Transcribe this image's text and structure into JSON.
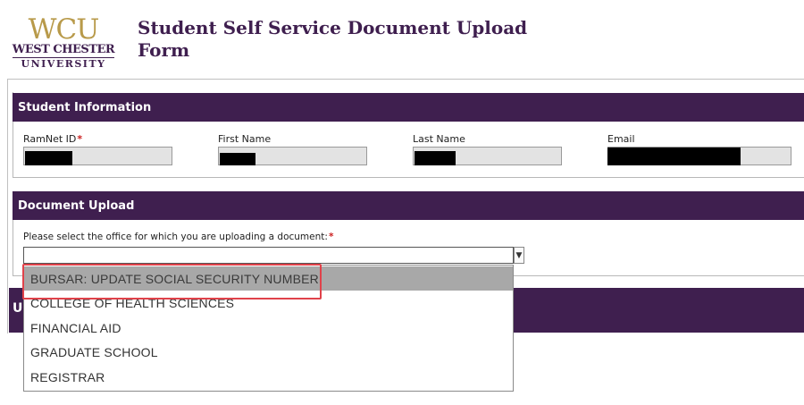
{
  "logo": {
    "abbrev": "WCU",
    "line1": "WEST CHESTER",
    "line2": "UNIVERSITY"
  },
  "page_title": "Student Self Service Document Upload Form",
  "student_info": {
    "header": "Student Information",
    "fields": {
      "ramnet_id": {
        "label": "RamNet ID",
        "required_mark": "*"
      },
      "first_name": {
        "label": "First Name"
      },
      "last_name": {
        "label": "Last Name"
      },
      "email": {
        "label": "Email"
      }
    }
  },
  "document_upload": {
    "header": "Document Upload",
    "office_prompt": "Please select the office for which you are uploading a document:",
    "required_mark": "*",
    "selected_value": "",
    "options": [
      "BURSAR: UPDATE SOCIAL SECURITY NUMBER",
      "COLLEGE OF HEALTH SCIENCES",
      "FINANCIAL AID",
      "GRADUATE SCHOOL",
      "REGISTRAR"
    ],
    "highlighted_option_index": 0
  },
  "hidden_section": {
    "header_initial": "U"
  },
  "colors": {
    "brand_purple": "#3f1f4f",
    "brand_gold": "#b89a4a",
    "highlight_red": "#e0424a",
    "option_hover": "#a8a8a8"
  },
  "icons": {
    "dropdown_arrow": "chevron-down-icon"
  }
}
